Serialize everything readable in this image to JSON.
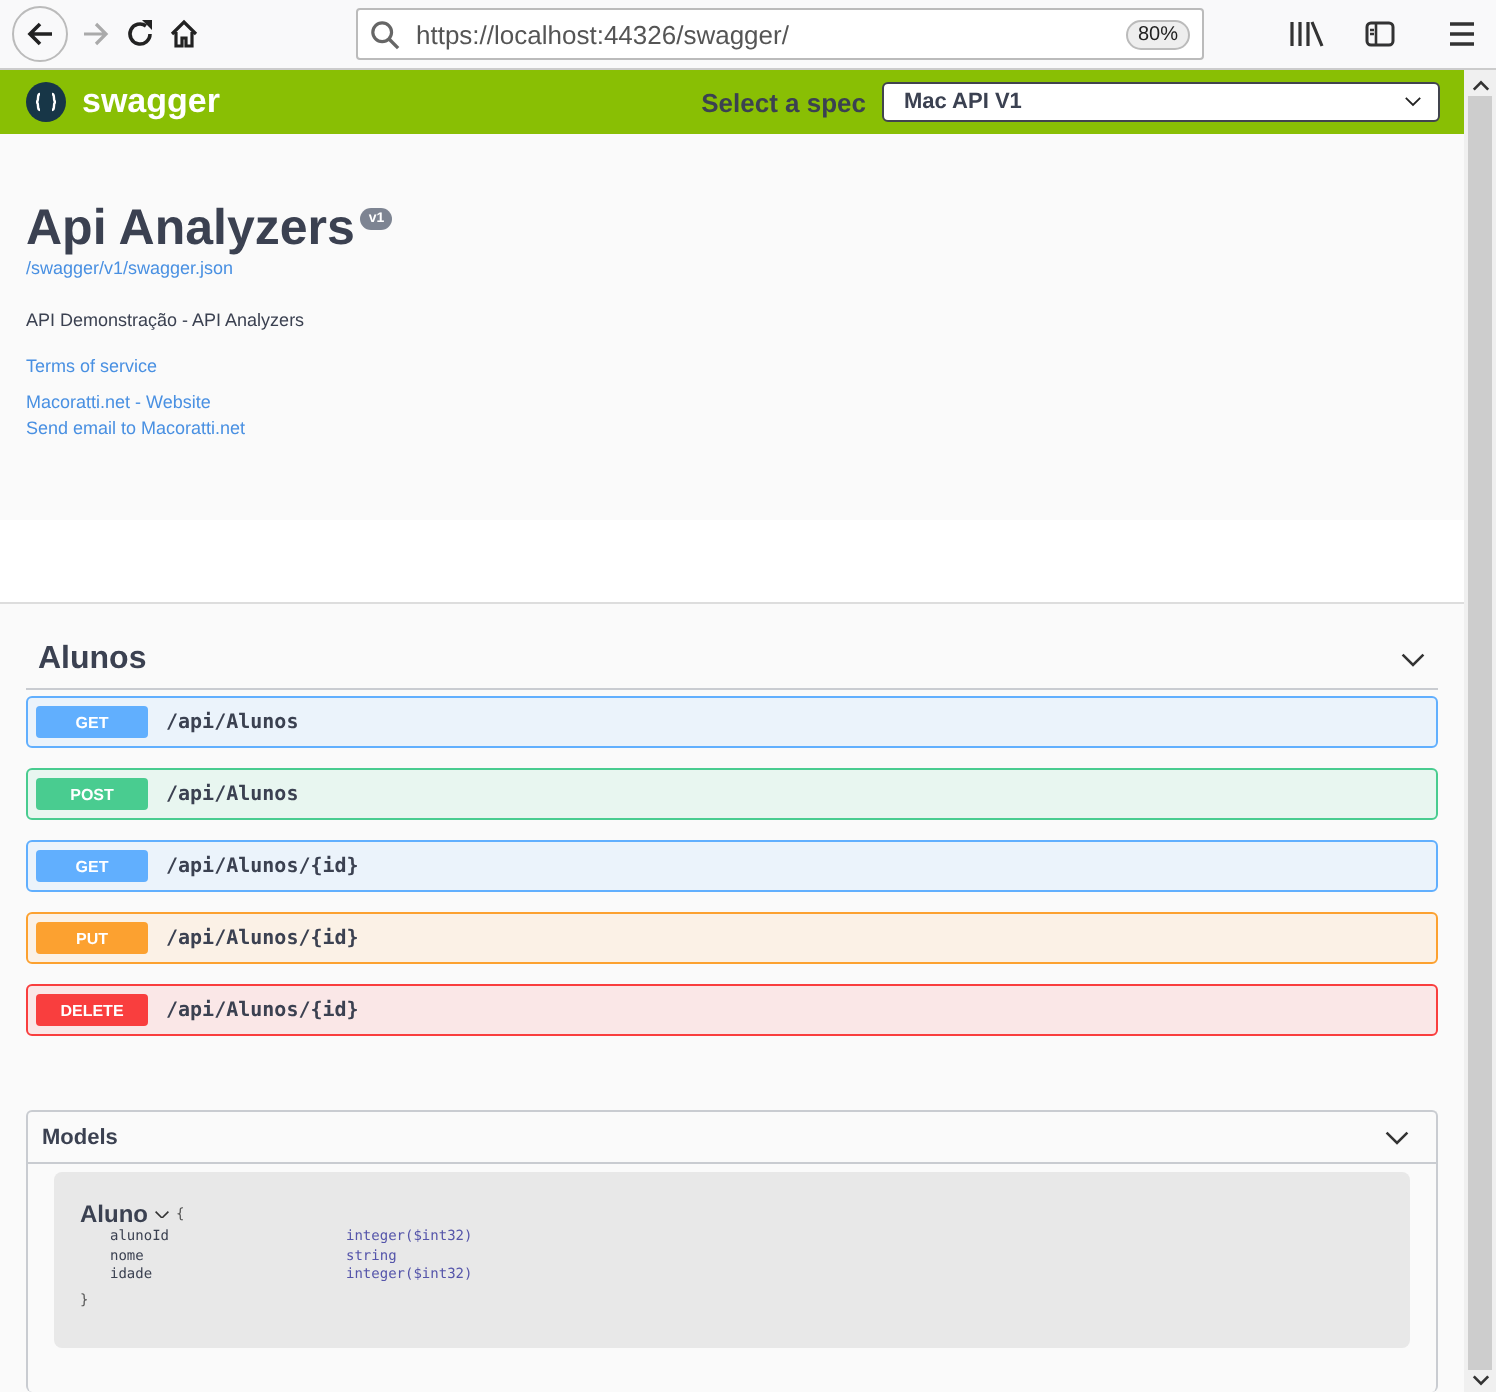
{
  "browser": {
    "url": "https://localhost:44326/swagger/",
    "zoom": "80%"
  },
  "topbar": {
    "logo": "swagger",
    "spec_label": "Select a spec",
    "spec_value": "Mac API V1"
  },
  "info": {
    "title": "Api Analyzers",
    "version": "v1",
    "spec_link": "/swagger/v1/swagger.json",
    "description": "API Demonstração - API Analyzers",
    "links": [
      "Terms of service",
      "Macoratti.net - Website",
      "Send email to Macoratti.net"
    ]
  },
  "tag": {
    "name": "Alunos",
    "expanded": true,
    "operations": [
      {
        "kind": "get",
        "method": "GET",
        "path": "/api/Alunos"
      },
      {
        "kind": "post",
        "method": "POST",
        "path": "/api/Alunos"
      },
      {
        "kind": "get",
        "method": "GET",
        "path": "/api/Alunos/{id}"
      },
      {
        "kind": "put",
        "method": "PUT",
        "path": "/api/Alunos/{id}"
      },
      {
        "kind": "delete",
        "method": "DELETE",
        "path": "/api/Alunos/{id}"
      }
    ]
  },
  "models": {
    "title": "Models",
    "expanded": true,
    "model": {
      "name": "Aluno",
      "open_brace": "{",
      "close_brace": "}",
      "properties": [
        {
          "name": "alunoId",
          "type": "integer($int32)"
        },
        {
          "name": "nome",
          "type": "string"
        },
        {
          "name": "idade",
          "type": "integer($int32)"
        }
      ]
    }
  }
}
